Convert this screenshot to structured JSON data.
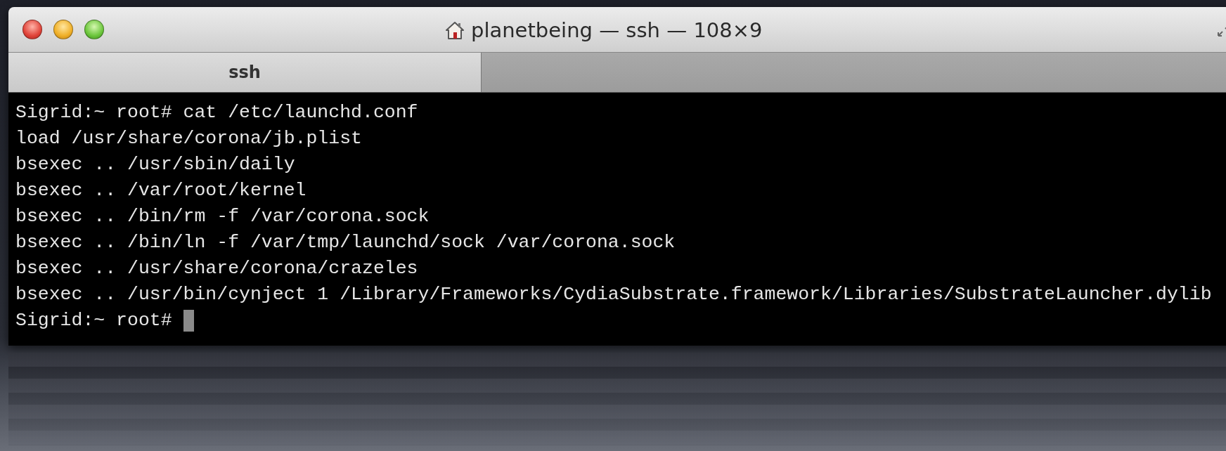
{
  "window": {
    "title": "planetbeing — ssh — 108×9"
  },
  "tabs": [
    {
      "label": "ssh",
      "selected": true
    }
  ],
  "terminal": {
    "lines": [
      "Sigrid:~ root# cat /etc/launchd.conf",
      "load /usr/share/corona/jb.plist",
      "bsexec .. /usr/sbin/daily",
      "bsexec .. /var/root/kernel",
      "bsexec .. /bin/rm -f /var/corona.sock",
      "bsexec .. /bin/ln -f /var/tmp/launchd/sock /var/corona.sock",
      "bsexec .. /usr/share/corona/crazeles",
      "bsexec .. /usr/bin/cynject 1 /Library/Frameworks/CydiaSubstrate.framework/Libraries/SubstrateLauncher.dylib",
      "Sigrid:~ root# "
    ]
  }
}
